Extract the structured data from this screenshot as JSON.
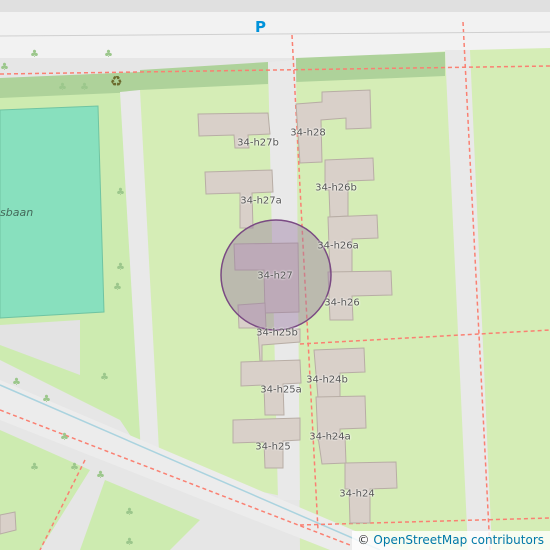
{
  "map": {
    "parking_symbol": "P",
    "recycling_icon": "recycling-icon",
    "area_label": "sbaan",
    "attribution": {
      "symbol": "©",
      "text": "OpenStreetMap contributors"
    },
    "colors": {
      "background": "#e6e6e6",
      "grass": "#cdebb0",
      "pitch": "#88e0be",
      "building": "#d9d0c9",
      "building_outline": "#b8ada5",
      "footpath": "#fa8072",
      "marker_fill": "#9b7da5",
      "marker_stroke": "#7a4a83",
      "waterway": "#aad3df"
    },
    "building_labels": [
      "34-h28",
      "34-h27b",
      "34-h26b",
      "34-h27a",
      "34-h26a",
      "34-h27",
      "34-h26",
      "34-h25b",
      "34-h24b",
      "34-h25a",
      "34-h24a",
      "34-h25",
      "34-h24"
    ]
  }
}
